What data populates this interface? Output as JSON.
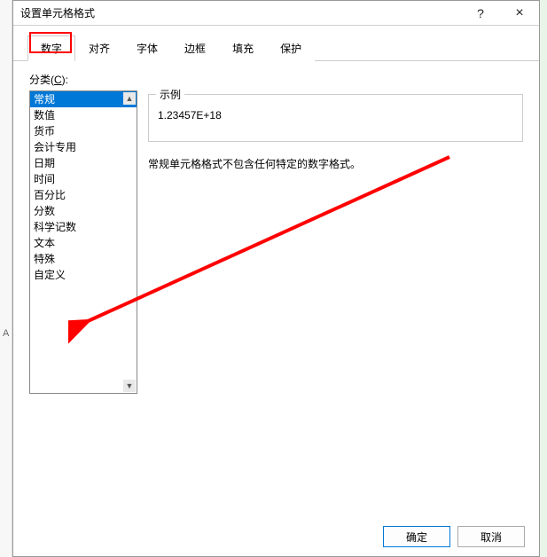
{
  "dialog": {
    "title": "设置单元格格式",
    "help_symbol": "?",
    "close_symbol": "×"
  },
  "tabs": [
    {
      "label": "数字",
      "active": true
    },
    {
      "label": "对齐",
      "active": false
    },
    {
      "label": "字体",
      "active": false
    },
    {
      "label": "边框",
      "active": false
    },
    {
      "label": "填充",
      "active": false
    },
    {
      "label": "保护",
      "active": false
    }
  ],
  "category": {
    "label_prefix": "分类(",
    "label_accel": "C",
    "label_suffix": "):",
    "items": [
      "常规",
      "数值",
      "货币",
      "会计专用",
      "日期",
      "时间",
      "百分比",
      "分数",
      "科学记数",
      "文本",
      "特殊",
      "自定义"
    ],
    "selected_index": 0,
    "scroll_up": "▲",
    "scroll_down": "▼"
  },
  "sample": {
    "label": "示例",
    "value": "1.23457E+18"
  },
  "description": "常规单元格格式不包含任何特定的数字格式。",
  "buttons": {
    "ok": "确定",
    "cancel": "取消"
  },
  "bg": {
    "col_a": "A"
  }
}
